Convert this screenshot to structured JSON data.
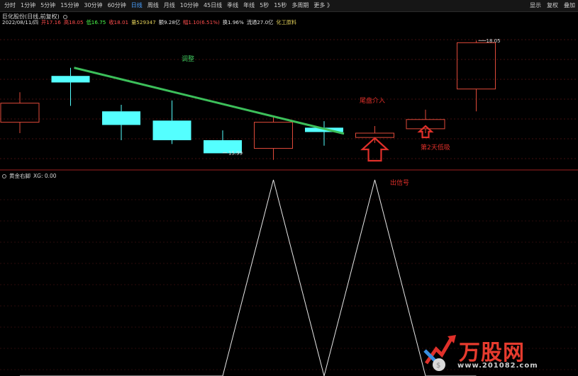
{
  "toolbar": {
    "periods": [
      "分时",
      "1分钟",
      "5分钟",
      "15分钟",
      "30分钟",
      "60分钟",
      "日线",
      "周线",
      "月线",
      "10分钟",
      "45日线",
      "季线",
      "年线",
      "5秒",
      "15秒",
      "多周期",
      "更多 》"
    ],
    "active_period": "日线",
    "actions": [
      "显示",
      "复权",
      "叠加"
    ]
  },
  "stock": {
    "title": "巨化股份(日线,前复权)",
    "date": "2022/08/11/四",
    "open": "开17.16",
    "high": "高18.05",
    "low": "低16.75",
    "close": "收18.01",
    "volume": "量529347",
    "amount": "额9.28亿",
    "change": "幅1.10(6.51%)",
    "turnover": "换1.96%",
    "float_cap": "流通27.0亿",
    "sector": "化工原料"
  },
  "indicator": {
    "name": "黄金右脚",
    "value": "XG: 0.00"
  },
  "chart_data": [
    {
      "type": "candlestick",
      "title": "",
      "candles": [
        {
          "open": 16.55,
          "close": 16.9,
          "high": 17.1,
          "low": 16.35,
          "color": "up"
        },
        {
          "open": 17.4,
          "close": 17.28,
          "high": 17.55,
          "low": 16.85,
          "color": "down"
        },
        {
          "open": 16.75,
          "close": 16.5,
          "high": 16.87,
          "low": 16.22,
          "color": "down"
        },
        {
          "open": 16.58,
          "close": 16.22,
          "high": 16.95,
          "low": 16.15,
          "color": "down"
        },
        {
          "open": 16.22,
          "close": 15.98,
          "high": 16.4,
          "low": 15.99,
          "color": "down"
        },
        {
          "open": 16.07,
          "close": 16.55,
          "high": 16.65,
          "low": 15.86,
          "color": "up"
        },
        {
          "open": 16.45,
          "close": 16.37,
          "high": 16.57,
          "low": 16.12,
          "color": "down"
        },
        {
          "open": 16.27,
          "close": 16.35,
          "high": 16.48,
          "low": 16.17,
          "color": "up"
        },
        {
          "open": 16.43,
          "close": 16.6,
          "high": 16.78,
          "low": 16.35,
          "color": "up"
        },
        {
          "open": 17.16,
          "close": 18.01,
          "high": 18.05,
          "low": 16.75,
          "color": "up"
        }
      ],
      "annotations": {
        "trend_label": "调整",
        "tail_label": "尾盘介入",
        "next_day_label": "第2天低吸",
        "high_label": "18.05",
        "low_label": "15.99"
      },
      "colors": {
        "up": "#e04a3a",
        "down": "#54ffff",
        "trend": "#3cbf5a",
        "arrow": "#e0302a"
      }
    },
    {
      "type": "line",
      "title": "",
      "series": [
        {
          "values": [
            0,
            0,
            0,
            0,
            0,
            1,
            0,
            1,
            0,
            0
          ]
        }
      ],
      "annotation": "出信号",
      "ylim": [
        0,
        1
      ]
    }
  ],
  "watermark": {
    "brand": "万股网",
    "url": "www.201082.com"
  }
}
